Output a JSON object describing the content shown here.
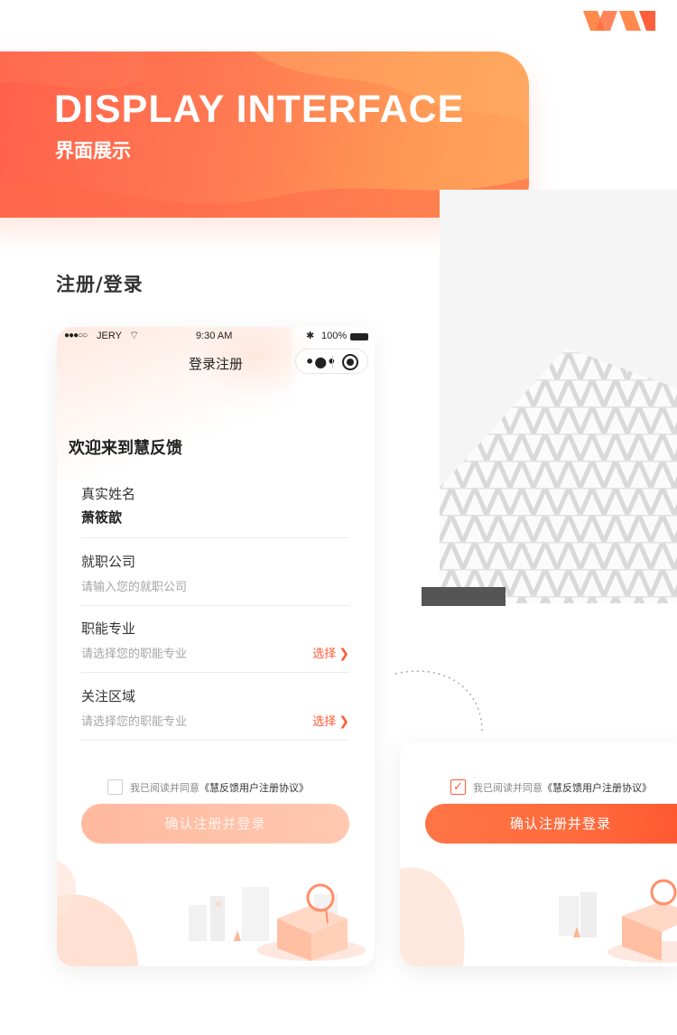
{
  "banner": {
    "title": "DISPLAY INTERFACE",
    "subtitle": "界面展示"
  },
  "section": {
    "title": "注册/登录"
  },
  "status_bar": {
    "signal": "●●●○○",
    "carrier": "JERY",
    "time": "9:30 AM",
    "battery": "100%"
  },
  "nav": {
    "title": "登录注册",
    "more_glyph": "•●•"
  },
  "form": {
    "welcome": "欢迎来到慧反馈",
    "fields": [
      {
        "label": "真实姓名",
        "value": "萧筱歆"
      },
      {
        "label": "就职公司",
        "placeholder": "请输入您的就职公司"
      },
      {
        "label": "职能专业",
        "placeholder": "请选择您的职能专业",
        "action": "选择"
      },
      {
        "label": "关注区域",
        "placeholder": "请选择您的职能专业",
        "action": "选择"
      }
    ]
  },
  "agreement": {
    "prefix": "我已阅读并同意",
    "link": "《慧反馈用户注册协议》",
    "checked_main": false,
    "checked_second": true
  },
  "submit": {
    "label": "确认注册并登录"
  },
  "colors": {
    "accent": "#ff5a36",
    "banner_start": "#ff5f4a",
    "banner_end": "#ffa35c"
  }
}
